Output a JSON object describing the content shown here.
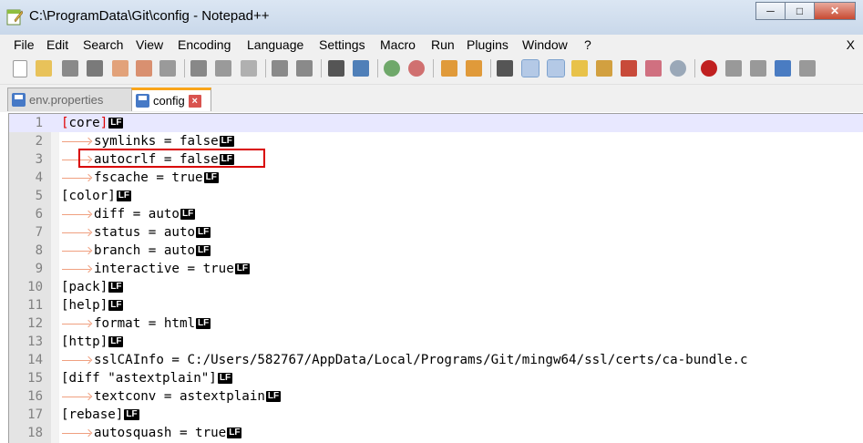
{
  "window": {
    "title": "C:\\ProgramData\\Git\\config - Notepad++",
    "controls": {
      "minimize": "─",
      "maximize": "□",
      "close": "✕"
    }
  },
  "menu": {
    "items": [
      "File",
      "Edit",
      "Search",
      "View",
      "Encoding",
      "Language",
      "Settings",
      "Macro",
      "Run",
      "Plugins",
      "Window",
      "?"
    ],
    "close_label": "X"
  },
  "tabs": [
    {
      "label": "env.properties",
      "active": false
    },
    {
      "label": "config",
      "active": true
    }
  ],
  "editor": {
    "eol_marker": "LF",
    "lines": [
      {
        "num": "1",
        "indent": false,
        "text": "[core]",
        "bracket_match": true
      },
      {
        "num": "2",
        "indent": true,
        "text": "symlinks = false"
      },
      {
        "num": "3",
        "indent": true,
        "text": "autocrlf = false"
      },
      {
        "num": "4",
        "indent": true,
        "text": "fscache = true"
      },
      {
        "num": "5",
        "indent": false,
        "text": "[color]"
      },
      {
        "num": "6",
        "indent": true,
        "text": "diff = auto"
      },
      {
        "num": "7",
        "indent": true,
        "text": "status = auto"
      },
      {
        "num": "8",
        "indent": true,
        "text": "branch = auto"
      },
      {
        "num": "9",
        "indent": true,
        "text": "interactive = true"
      },
      {
        "num": "10",
        "indent": false,
        "text": "[pack]"
      },
      {
        "num": "11",
        "indent": false,
        "text": "[help]"
      },
      {
        "num": "12",
        "indent": true,
        "text": "format = html"
      },
      {
        "num": "13",
        "indent": false,
        "text": "[http]"
      },
      {
        "num": "14",
        "indent": true,
        "text": "sslCAInfo = C:/Users/582767/AppData/Local/Programs/Git/mingw64/ssl/certs/ca-bundle.c",
        "no_eol": true
      },
      {
        "num": "15",
        "indent": false,
        "text": "[diff \"astextplain\"]"
      },
      {
        "num": "16",
        "indent": true,
        "text": "textconv = astextplain"
      },
      {
        "num": "17",
        "indent": false,
        "text": "[rebase]"
      },
      {
        "num": "18",
        "indent": true,
        "text": "autosquash = true"
      }
    ]
  },
  "toolbar": {
    "icons": [
      "new-file",
      "open-file",
      "save",
      "save-all",
      "close",
      "close-all",
      "print",
      "cut",
      "copy",
      "paste",
      "undo",
      "redo",
      "find",
      "replace",
      "zoom-in",
      "zoom-out",
      "sync-vertical",
      "sync-horizontal",
      "word-wrap",
      "show-all-characters",
      "indent-guide",
      "user-defined-language",
      "document-map",
      "function-list",
      "folder-as-workspace",
      "monitoring",
      "record-macro",
      "stop-recording",
      "playback-macro",
      "run-macro-multiple",
      "save-macro"
    ]
  },
  "colors": {
    "eol_bg": "#000000",
    "bracket": "#e00000",
    "highlight_box": "#d90000",
    "current_line": "#e8e8ff",
    "tab_accent": "#f9a51a"
  }
}
